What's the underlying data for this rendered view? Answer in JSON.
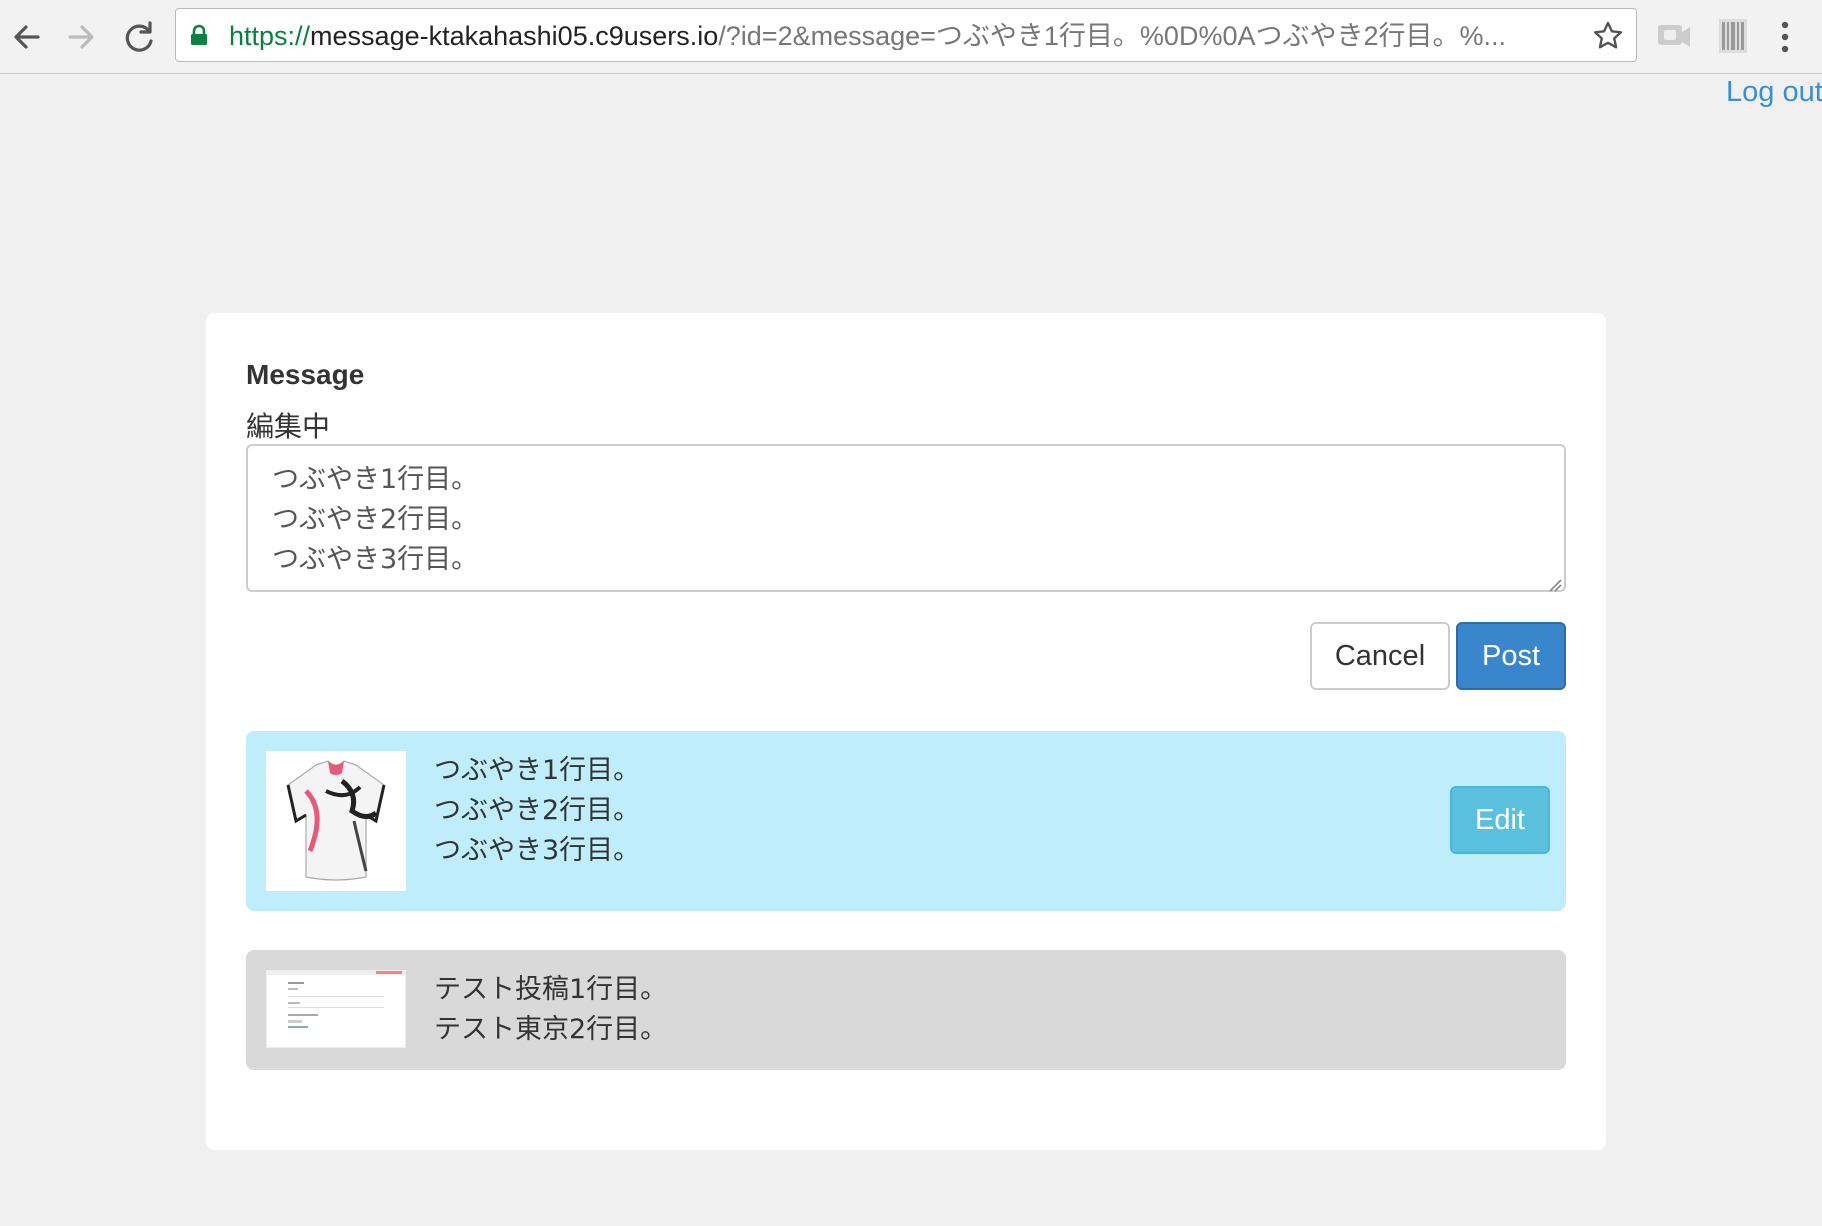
{
  "browser": {
    "url_scheme": "https://",
    "url_host": "message-ktakahashi05.c9users.io",
    "url_rest": "/?id=2&message=つぶやき1行目。%0D%0Aつぶやき2行目。%..."
  },
  "header": {
    "logout_label": "Log out"
  },
  "form": {
    "title": "Message",
    "status": "編集中",
    "textarea_value": "つぶやき1行目。\nつぶやき2行目。\nつぶやき3行目。",
    "cancel_label": "Cancel",
    "post_label": "Post"
  },
  "posts": [
    {
      "text": "つぶやき1行目。\nつぶやき2行目。\nつぶやき3行目。",
      "edit_label": "Edit",
      "highlight_color": "#bfedfb",
      "thumbnail": "cycling-jersey-image"
    },
    {
      "text": "テスト投稿1行目。\nテスト東京2行目。",
      "highlight_color": "#d9d9d9",
      "thumbnail": "login-page-screenshot-image"
    }
  ],
  "colors": {
    "primary": "#3a86cc",
    "info": "#5bc0de",
    "link": "#3a8fd3"
  }
}
